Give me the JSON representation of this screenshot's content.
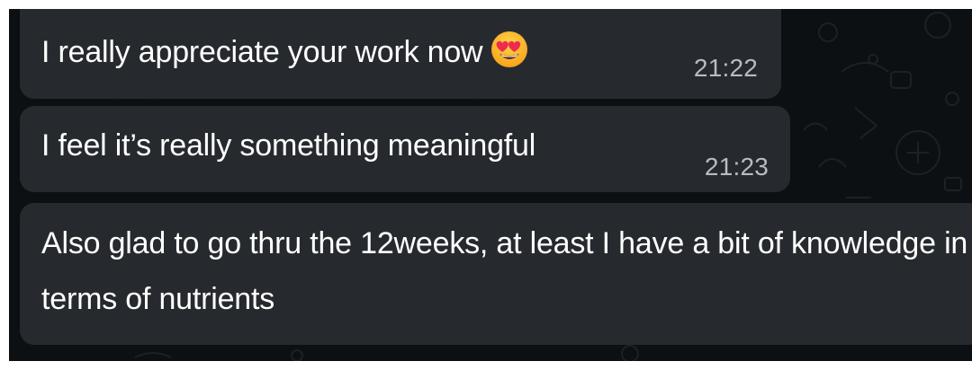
{
  "messages": [
    {
      "text": "I really appreciate your work now",
      "emoji": "smiling-face-with-heart-eyes",
      "time": "21:22"
    },
    {
      "text": "I feel it’s really something meaningful",
      "time": "21:23"
    },
    {
      "text": "Also glad to go thru the 12weeks, at least I have a bit of knowledge in terms of nutrients"
    }
  ],
  "colors": {
    "background": "#0c1013",
    "bubble": "#262a2e",
    "text": "#ffffff",
    "time": "#b8bcc2",
    "quote": "#d7dbe1"
  }
}
